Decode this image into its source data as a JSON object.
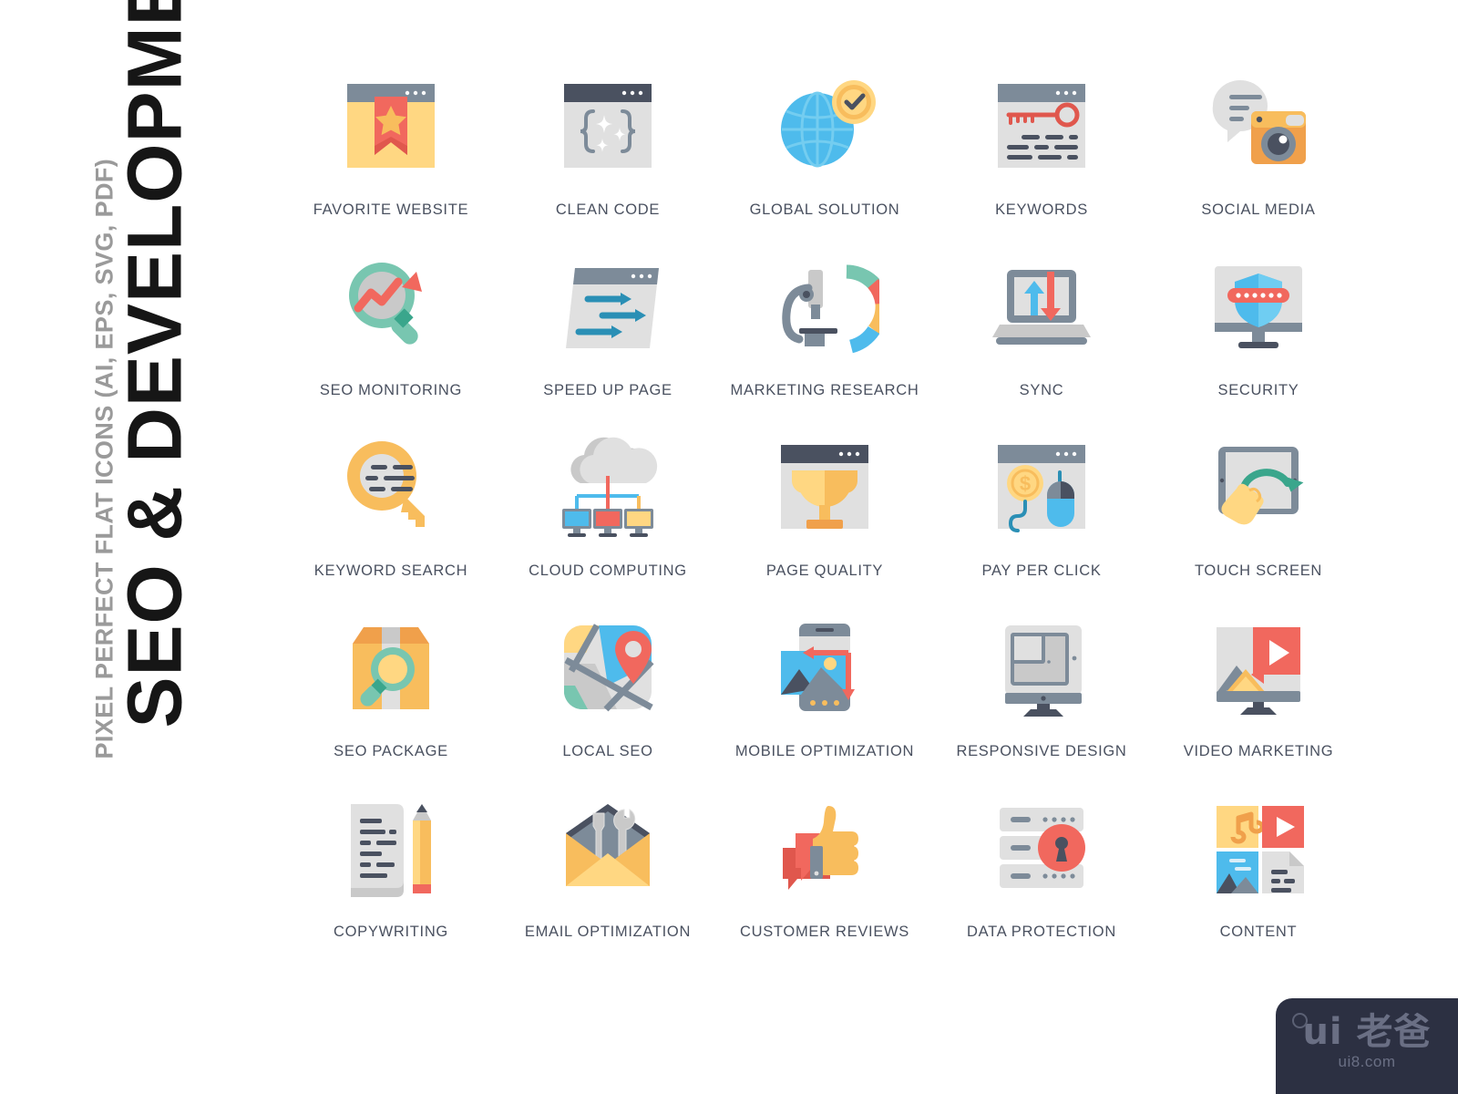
{
  "title": {
    "main": "SEO & DEVELOPMENT",
    "sub": "PIXEL PERFECT FLAT ICONS (AI, EPS, SVG, PDF)"
  },
  "watermark": {
    "logo": "ui 老爸",
    "url": "ui8.com"
  },
  "palette": {
    "slate": "#4a5160",
    "slate_dark": "#49505f",
    "blue_gray": "#7d8b99",
    "light_gray": "#e0e0e0",
    "mid_gray": "#c9c9c9",
    "red": "#f1685e",
    "red_dark": "#e0574d",
    "orange": "#f0a04b",
    "yellow": "#ffd782",
    "yellow_deep": "#f8bd5d",
    "teal": "#78c6b0",
    "green": "#3aa68c",
    "blue": "#4ebbec",
    "blue_dark": "#2a8fb5",
    "label": "#4a5160",
    "title_black": "#161616",
    "subtitle_gray": "#9a9a9a"
  },
  "icons": [
    {
      "id": "favorite-website",
      "label": "FAVORITE WEBSITE"
    },
    {
      "id": "clean-code",
      "label": "CLEAN CODE"
    },
    {
      "id": "global-solution",
      "label": "GLOBAL SOLUTION"
    },
    {
      "id": "keywords",
      "label": "KEYWORDS"
    },
    {
      "id": "social-media",
      "label": "SOCIAL MEDIA"
    },
    {
      "id": "seo-monitoring",
      "label": "SEO MONITORING"
    },
    {
      "id": "speed-up-page",
      "label": "SPEED UP PAGE"
    },
    {
      "id": "marketing-research",
      "label": "MARKETING RESEARCH"
    },
    {
      "id": "sync",
      "label": "SYNC"
    },
    {
      "id": "security",
      "label": "SECURITY"
    },
    {
      "id": "keyword-search",
      "label": "KEYWORD SEARCH"
    },
    {
      "id": "cloud-computing",
      "label": "CLOUD COMPUTING"
    },
    {
      "id": "page-quality",
      "label": "PAGE QUALITY"
    },
    {
      "id": "pay-per-click",
      "label": "PAY PER CLICK"
    },
    {
      "id": "touch-screen",
      "label": "TOUCH SCREEN"
    },
    {
      "id": "seo-package",
      "label": "SEO PACKAGE"
    },
    {
      "id": "local-seo",
      "label": "LOCAL SEO"
    },
    {
      "id": "mobile-optimization",
      "label": "MOBILE OPTIMIZATION"
    },
    {
      "id": "responsive-design",
      "label": "RESPONSIVE DESIGN"
    },
    {
      "id": "video-marketing",
      "label": "VIDEO MARKETING"
    },
    {
      "id": "copywriting",
      "label": "COPYWRITING"
    },
    {
      "id": "email-optimization",
      "label": "EMAIL OPTIMIZATION"
    },
    {
      "id": "customer-reviews",
      "label": "CUSTOMER REVIEWS"
    },
    {
      "id": "data-protection",
      "label": "DATA PROTECTION"
    },
    {
      "id": "content",
      "label": "CONTENT"
    }
  ]
}
